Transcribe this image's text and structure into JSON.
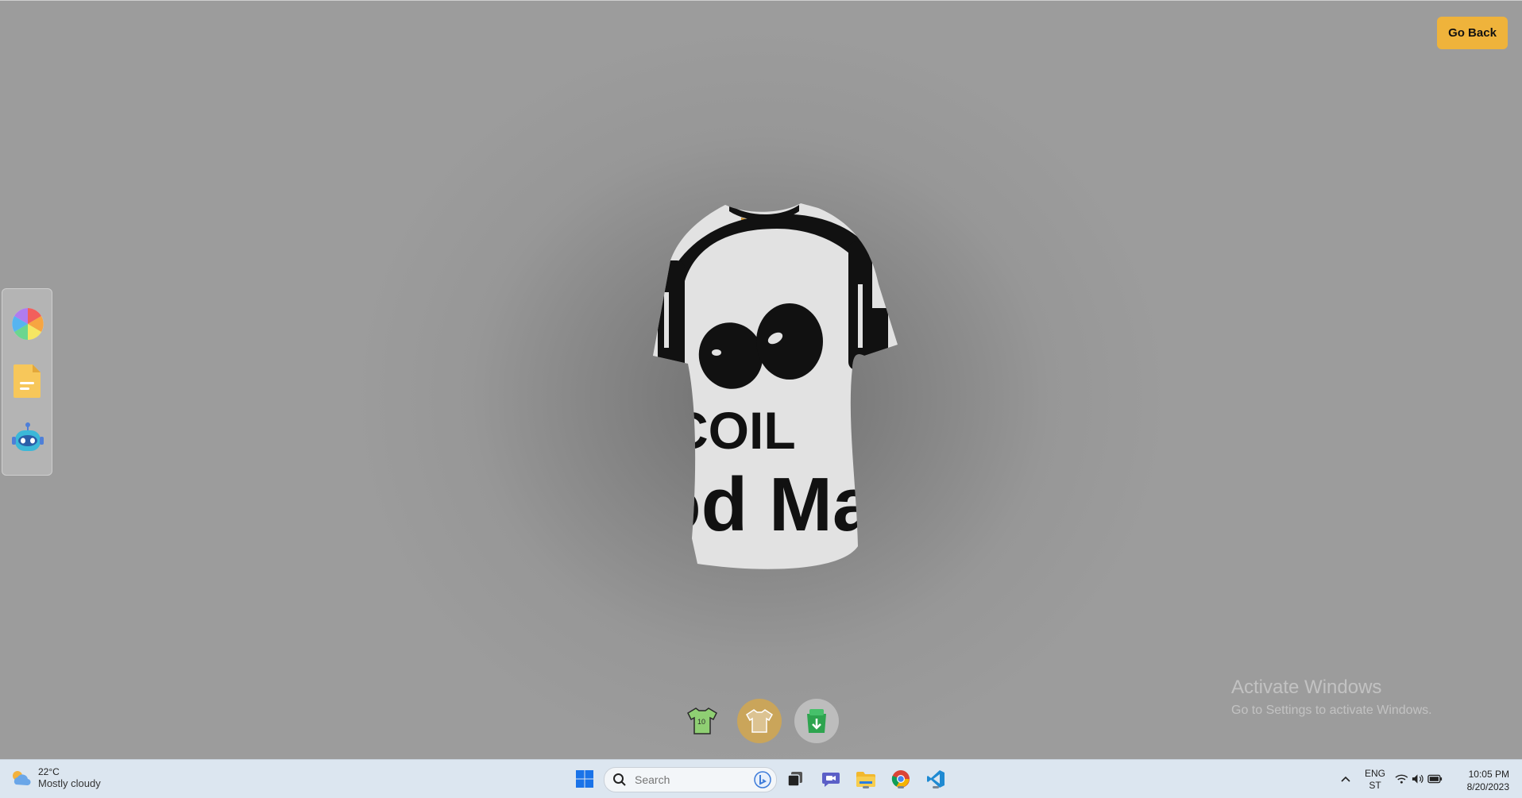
{
  "app": {
    "go_back_label": "Go Back"
  },
  "side_panel": {
    "tools": [
      {
        "name": "color-picker",
        "icon": "color-wheel-icon"
      },
      {
        "name": "file-picker",
        "icon": "file-icon"
      },
      {
        "name": "ai-picker",
        "icon": "robot-icon"
      }
    ]
  },
  "shirt_design": {
    "line1": "COIL",
    "line2": "od Ma"
  },
  "bottom_tools": [
    {
      "name": "logo-shirt",
      "icon": "shirt-logo-icon",
      "badge": "10"
    },
    {
      "name": "stylish-shirt",
      "icon": "shirt-full-icon"
    },
    {
      "name": "download",
      "icon": "download-icon"
    }
  ],
  "watermark": {
    "title": "Activate Windows",
    "subtitle": "Go to Settings to activate Windows."
  },
  "taskbar": {
    "weather_temp": "22°C",
    "weather_desc": "Mostly cloudy",
    "search_placeholder": "Search",
    "lang_line1": "ENG",
    "lang_line2": "ST",
    "time": "10:05 PM",
    "date": "8/20/2023"
  },
  "colors": {
    "accent": "#EFB33B",
    "background": "#9B9B9B",
    "shirt": "#E2E2E2"
  }
}
